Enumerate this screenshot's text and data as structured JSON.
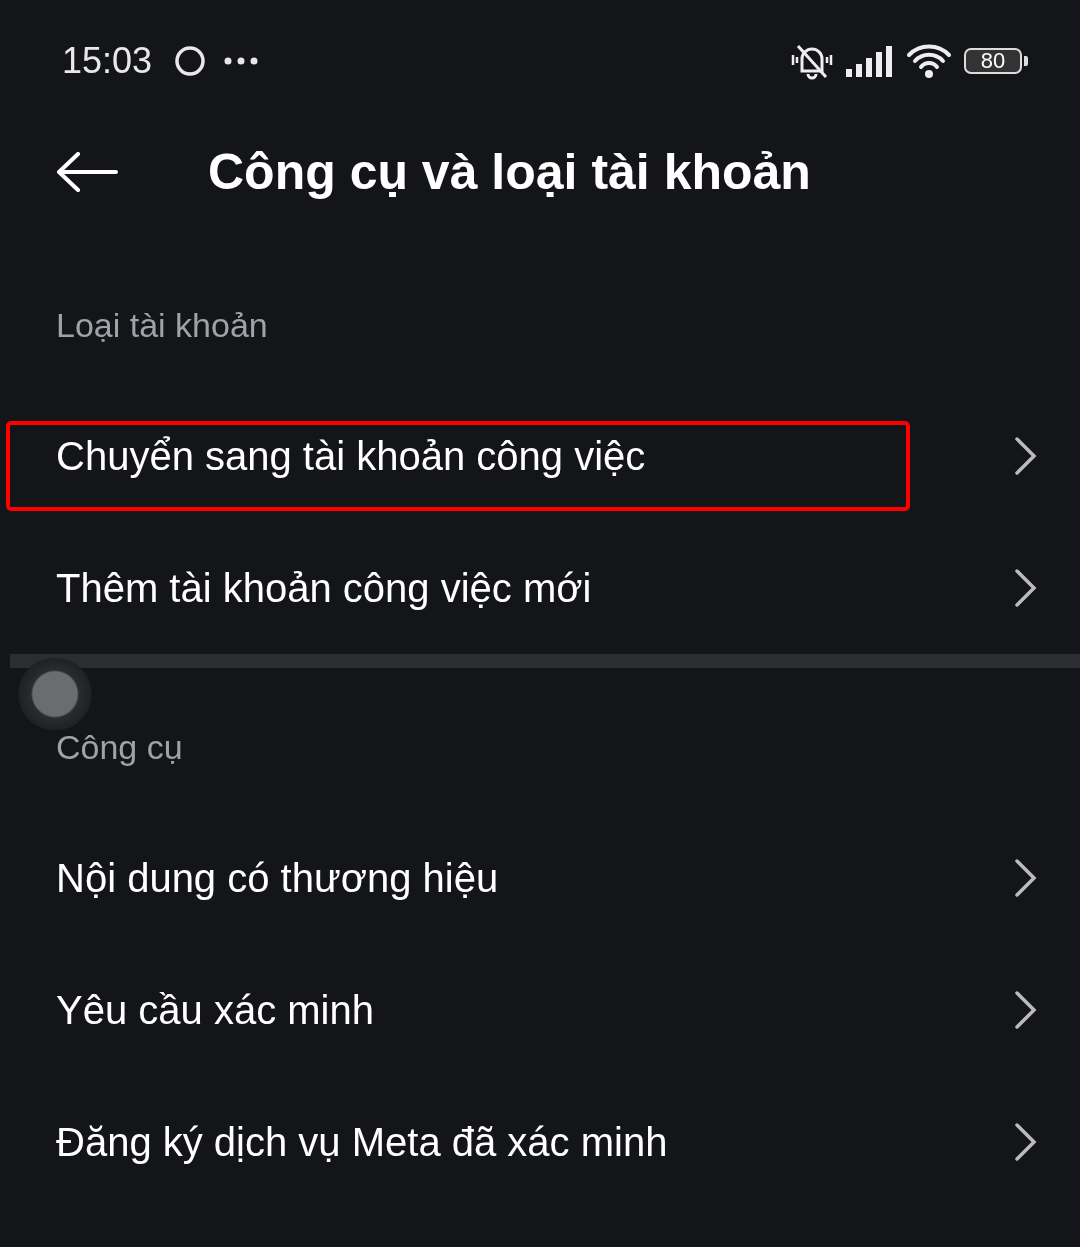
{
  "status_bar": {
    "time": "15:03",
    "battery": "80"
  },
  "header": {
    "title": "Công cụ và loại tài khoản"
  },
  "sections": [
    {
      "title": "Loại tài khoản",
      "items": [
        {
          "label": "Chuyển sang tài khoản công việc",
          "highlighted": true
        },
        {
          "label": "Thêm tài khoản công việc mới",
          "highlighted": false
        }
      ]
    },
    {
      "title": "Công cụ",
      "items": [
        {
          "label": "Nội dung có thương hiệu",
          "highlighted": false
        },
        {
          "label": "Yêu cầu xác minh",
          "highlighted": false
        },
        {
          "label": "Đăng ký dịch vụ Meta đã xác minh",
          "highlighted": false
        }
      ]
    }
  ]
}
